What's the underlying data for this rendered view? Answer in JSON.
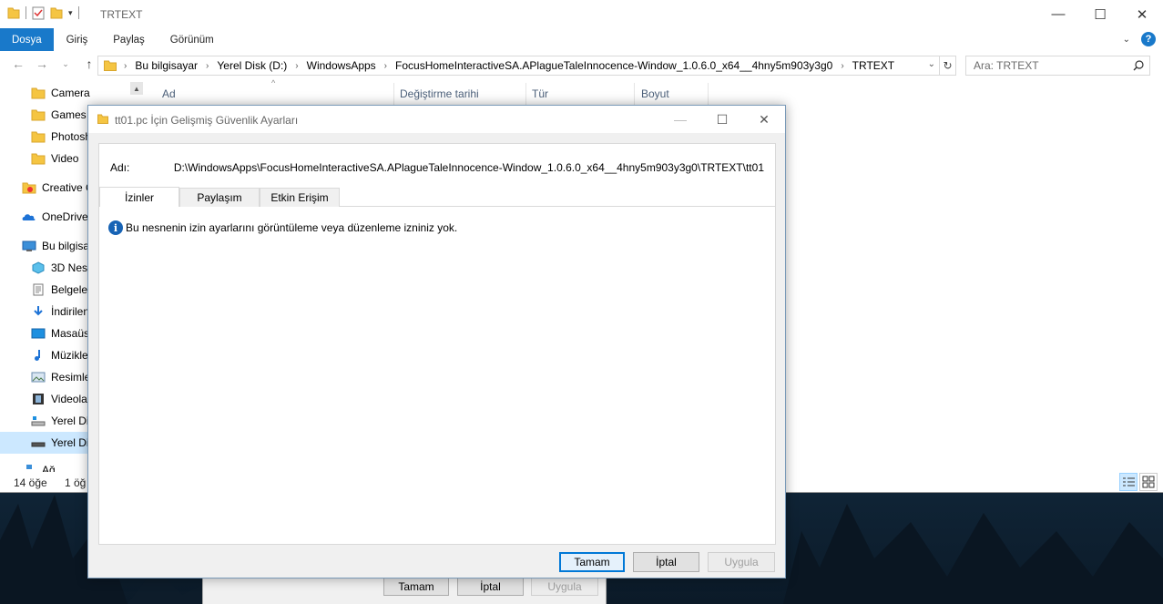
{
  "explorer": {
    "title": "TRTEXT",
    "ribbon_tabs": [
      "Dosya",
      "Giriş",
      "Paylaş",
      "Görünüm"
    ],
    "breadcrumb": [
      "Bu bilgisayar",
      "Yerel Disk (D:)",
      "WindowsApps",
      "FocusHomeInteractiveSA.APlagueTaleInnocence-Window_1.0.6.0_x64__4hny5m903y3g0",
      "TRTEXT"
    ],
    "search_placeholder": "Ara: TRTEXT",
    "nav_items": [
      {
        "label": "Camera",
        "icon": "folder-icon"
      },
      {
        "label": "Games",
        "icon": "folder-icon"
      },
      {
        "label": "Photosh",
        "icon": "folder-icon"
      },
      {
        "label": "Video",
        "icon": "folder-icon"
      },
      {
        "label": "Creative C",
        "icon": "creative-cloud-icon"
      },
      {
        "label": "OneDrive",
        "icon": "onedrive-icon"
      },
      {
        "label": "Bu bilgisa",
        "icon": "computer-icon"
      },
      {
        "label": "3D Nesn",
        "icon": "3d-objects-icon"
      },
      {
        "label": "Belgeler",
        "icon": "documents-icon"
      },
      {
        "label": "İndirilen",
        "icon": "downloads-icon"
      },
      {
        "label": "Masaüst",
        "icon": "desktop-icon"
      },
      {
        "label": "Müzikler",
        "icon": "music-icon"
      },
      {
        "label": "Resimler",
        "icon": "pictures-icon"
      },
      {
        "label": "Videolar",
        "icon": "videos-icon"
      },
      {
        "label": "Yerel Dis",
        "icon": "drive-icon"
      },
      {
        "label": "Yerel Dis",
        "icon": "drive-icon"
      },
      {
        "label": "Ağ",
        "icon": "network-icon"
      }
    ],
    "columns": [
      "Ad",
      "Değiştirme tarihi",
      "Tür",
      "Boyut"
    ],
    "status_items": "14 öğe",
    "status_selected": "1 öğ"
  },
  "behind_dialog": {
    "ok": "Tamam",
    "cancel": "İptal",
    "apply": "Uygula"
  },
  "dialog": {
    "title": "tt01.pc İçin Gelişmiş Güvenlik Ayarları",
    "name_label": "Adı:",
    "name_value": "D:\\WindowsApps\\FocusHomeInteractiveSA.APlagueTaleInnocence-Window_1.0.6.0_x64__4hny5m903y3g0\\TRTEXT\\tt01",
    "tabs": [
      "İzinler",
      "Paylaşım",
      "Etkin Erişim"
    ],
    "message": "Bu nesnenin izin ayarlarını görüntüleme veya düzenleme izniniz yok.",
    "ok": "Tamam",
    "cancel": "İptal",
    "apply": "Uygula"
  },
  "colors": {
    "accent": "#1979ca",
    "selection": "#cce8ff",
    "info_icon": "#1763b5"
  }
}
